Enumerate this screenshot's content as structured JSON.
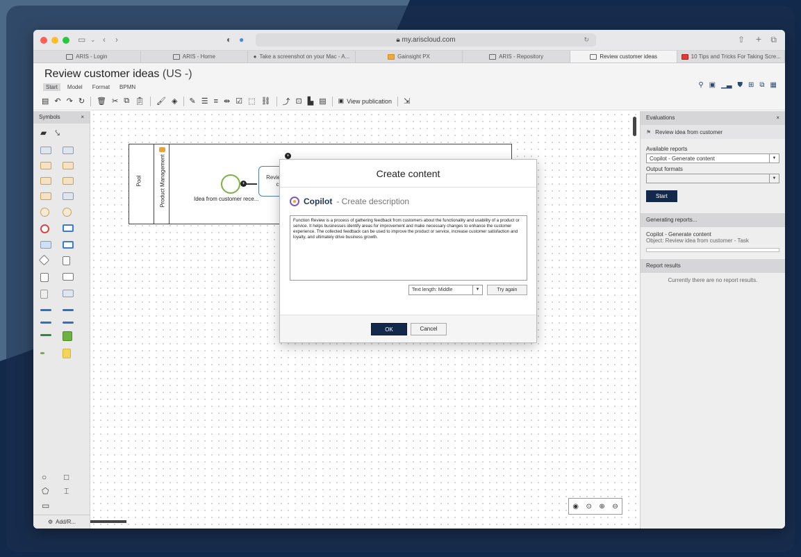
{
  "browser": {
    "url": "my.ariscloud.com",
    "tabs": [
      {
        "label": "ARIS - Login"
      },
      {
        "label": "ARIS - Home"
      },
      {
        "label": "Take a screenshot on your Mac - A..."
      },
      {
        "label": "Gainsight PX"
      },
      {
        "label": "ARIS - Repository"
      },
      {
        "label": "Review customer ideas"
      },
      {
        "label": "10 Tips and Tricks For Taking Scre..."
      }
    ],
    "active_tab": 5
  },
  "app": {
    "title": "Review customer ideas",
    "title_suffix": "(US -)",
    "menu": [
      "Start",
      "Model",
      "Format",
      "BPMN"
    ],
    "view_publication": "View publication"
  },
  "sidebar": {
    "title": "Symbols",
    "add_label": "Add/R..."
  },
  "diagram": {
    "pool_label": "Pool",
    "lane_label": "Product Management",
    "event_label": "Idea from customer rece...",
    "task_label": "Review idea from customer"
  },
  "evaluations": {
    "title": "Evaluations",
    "object": "Review idea from customer",
    "available_reports_label": "Available reports",
    "available_reports_value": "Copilot - Generate content",
    "output_formats_label": "Output formats",
    "start_label": "Start",
    "generating_label": "Generating reports...",
    "gen_report_name": "Copilot - Generate content",
    "gen_report_object": "Object: Review idea from customer - Task",
    "results_label": "Report results",
    "no_results": "Currently there are no report results."
  },
  "modal": {
    "title": "Create content",
    "copilot": "Copilot",
    "subtitle": "- Create description",
    "text": "Function Review is a process of gathering feedback from customers about the functionality and usability of a product or service. It helps businesses identify areas for improvement and make necessary changes to enhance the customer experience. The collected feedback can be used to improve the product or service, increase customer satisfaction and loyalty, and ultimately drive business growth.",
    "text_length": "Text length: Middle",
    "try_again": "Try again",
    "ok": "OK",
    "cancel": "Cancel"
  },
  "colors": {
    "primary": "#13294b",
    "event": "#7cb342",
    "task_border": "#4d7fa8"
  }
}
